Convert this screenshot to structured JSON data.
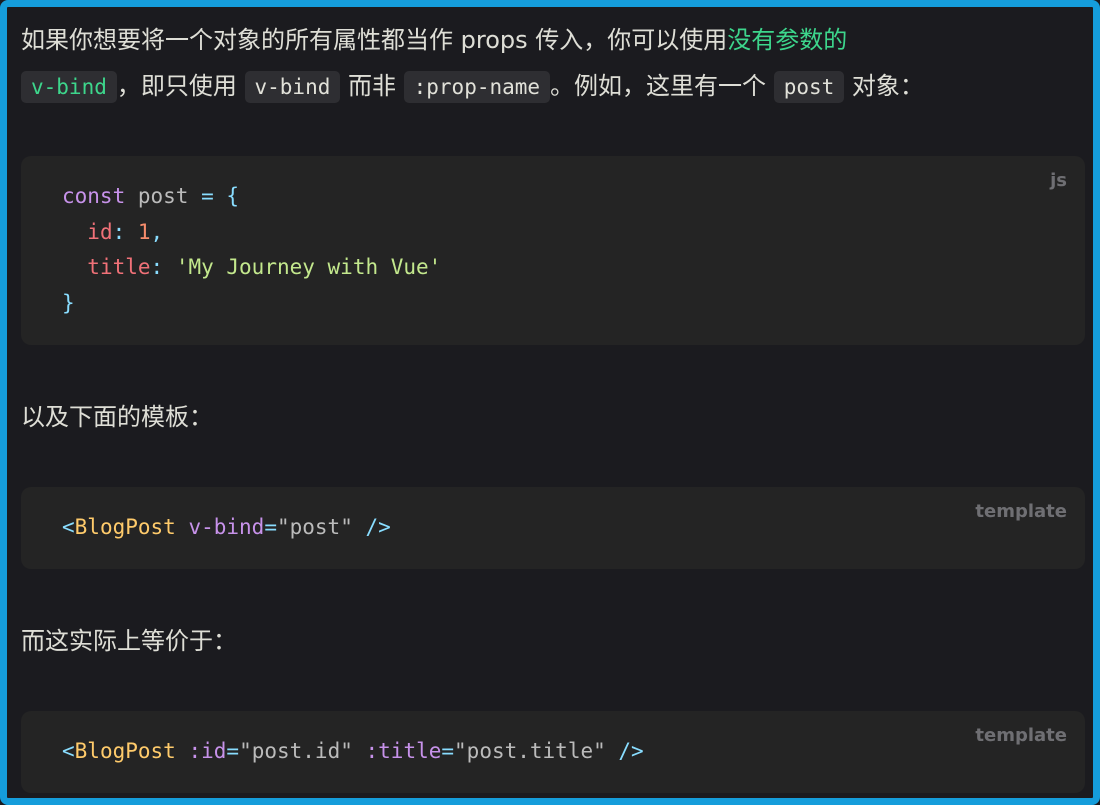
{
  "intro": {
    "text_before_link": "如果你想要将一个对象的所有属性都当作 props 传入，你可以使用",
    "link_text": "没有参数的",
    "link_code": "v-bind",
    "text_after_link": "，即只使用 ",
    "code_vbind": "v-bind",
    "text_not": " 而非 ",
    "code_propname": ":prop-name",
    "text_example": "。例如，这里有一个 ",
    "code_post": "post",
    "text_object": " 对象："
  },
  "code_js": {
    "lang": "js",
    "kw_const": "const",
    "var_post": " post ",
    "op_eq": "=",
    "brace_open": "{",
    "prop_id": "id",
    "colon1": ": ",
    "num_1": "1",
    "comma": ",",
    "prop_title": "title",
    "colon2": ": ",
    "str_title": "'My Journey with Vue'",
    "brace_close": "}"
  },
  "para_template": "以及下面的模板：",
  "code_template1": {
    "lang": "template",
    "lt": "<",
    "tag": "BlogPost",
    "attr": "v-bind",
    "eq": "=",
    "val": "\"post\"",
    "end": "/>"
  },
  "para_equivalent": "而这实际上等价于：",
  "code_template2": {
    "lang": "template",
    "lt": "<",
    "tag": "BlogPost",
    "attr_id": ":id",
    "eq1": "=",
    "val_id": "\"post.id\"",
    "attr_title": ":title",
    "eq2": "=",
    "val_title": "\"post.title\"",
    "end": "/>"
  },
  "colors": {
    "border": "#159ddb",
    "background": "#1b1b1f",
    "code_background": "#242424",
    "link": "#3dd68c"
  }
}
